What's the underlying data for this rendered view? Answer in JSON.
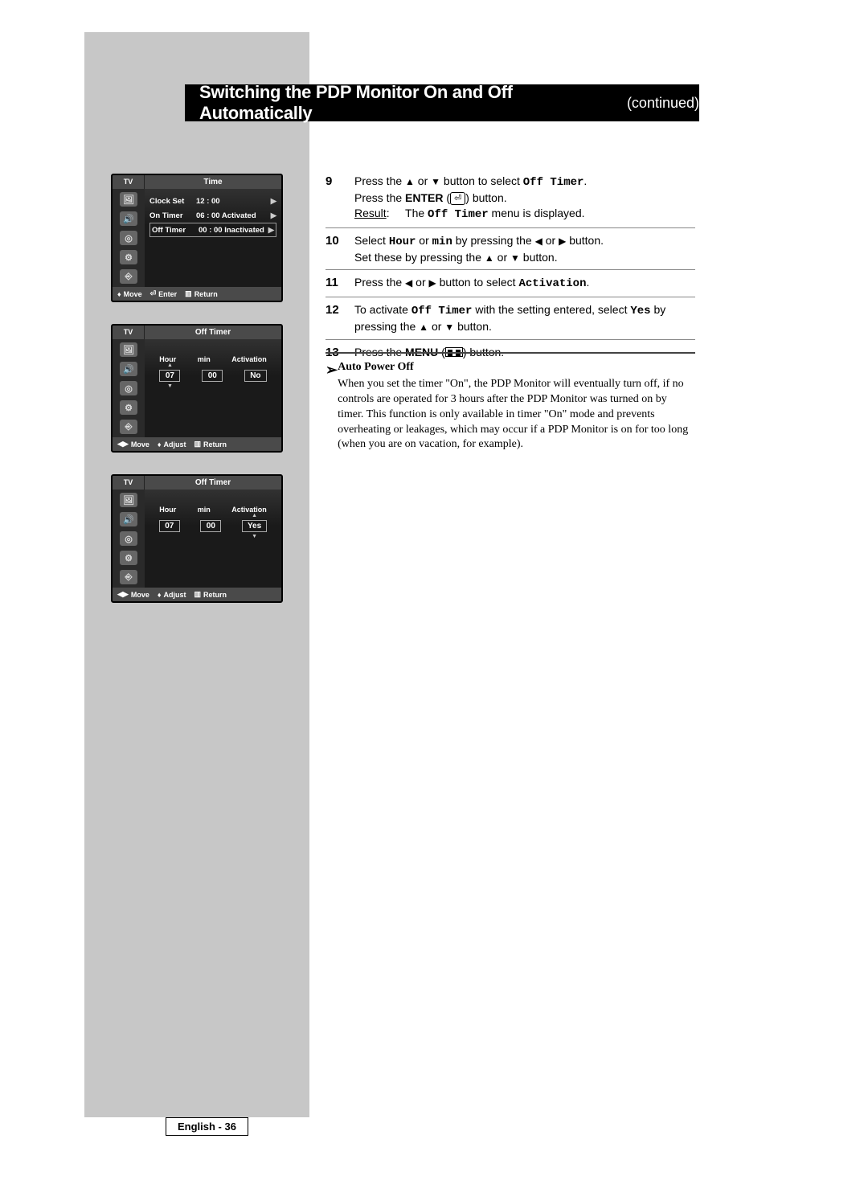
{
  "title": {
    "main": "Switching the PDP Monitor On and Off Automatically",
    "continued": "(continued)"
  },
  "osd1": {
    "tv": "TV",
    "title": "Time",
    "rows": [
      {
        "label": "Clock Set",
        "value": "12 : 00"
      },
      {
        "label": "On Timer",
        "value": "06 : 00  Activated"
      },
      {
        "label": "Off Timer",
        "value": "00 : 00  Inactivated"
      }
    ],
    "footer": {
      "move": "Move",
      "enter": "Enter",
      "return": "Return"
    }
  },
  "osd2": {
    "tv": "TV",
    "title": "Off Timer",
    "headers": {
      "hour": "Hour",
      "min": "min",
      "activation": "Activation"
    },
    "values": {
      "hour": "07",
      "min": "00",
      "activation": "No"
    },
    "footer": {
      "move": "Move",
      "adjust": "Adjust",
      "return": "Return"
    }
  },
  "osd3": {
    "tv": "TV",
    "title": "Off Timer",
    "headers": {
      "hour": "Hour",
      "min": "min",
      "activation": "Activation"
    },
    "values": {
      "hour": "07",
      "min": "00",
      "activation": "Yes"
    },
    "footer": {
      "move": "Move",
      "adjust": "Adjust",
      "return": "Return"
    }
  },
  "steps": {
    "s9": {
      "num": "9",
      "l1a": "Press the ",
      "l1b": " or ",
      "l1c": " button to select ",
      "l1d": "Off Timer",
      "l1e": ".",
      "l2a": "Press the ",
      "l2b": "ENTER",
      "l2c": " (",
      "l2d": ") button.",
      "l3a": "Result",
      "l3b": ":",
      "l3c": "The ",
      "l3d": "Off Timer",
      "l3e": " menu is displayed."
    },
    "s10": {
      "num": "10",
      "l1a": "Select ",
      "l1b": "Hour",
      "l1c": " or ",
      "l1d": "min",
      "l1e": " by pressing the ",
      "l1f": " or ",
      "l1g": " button.",
      "l2a": "Set these by pressing the ",
      "l2b": " or ",
      "l2c": " button."
    },
    "s11": {
      "num": "11",
      "a": "Press the ",
      "b": " or ",
      "c": " button to select ",
      "d": "Activation",
      "e": "."
    },
    "s12": {
      "num": "12",
      "a": "To activate ",
      "b": "Off Timer",
      "c": " with the setting entered, select ",
      "d": "Yes",
      "e": " by pressing the ",
      "f": " or ",
      "g": " button."
    },
    "s13": {
      "num": "13",
      "a": "Press the ",
      "b": "MENU",
      "c": " (",
      "d": ") button."
    }
  },
  "note": {
    "symbol": "➢",
    "title": "Auto Power Off",
    "body": "When you set the timer \"On\", the PDP Monitor will eventually turn off, if no controls are operated for 3 hours after the PDP Monitor was turned on by timer. This function is only available in timer \"On\" mode and prevents overheating or leakages, which may occur if a PDP Monitor is on for too long (when you are on vacation, for example)."
  },
  "page_number": "English - 36",
  "glyphs": {
    "up": "▲",
    "down": "▼",
    "left": "◀",
    "right": "▶",
    "updown": "♦",
    "leftright": "◀▶",
    "enter": "⏎",
    "menu": "▥"
  }
}
